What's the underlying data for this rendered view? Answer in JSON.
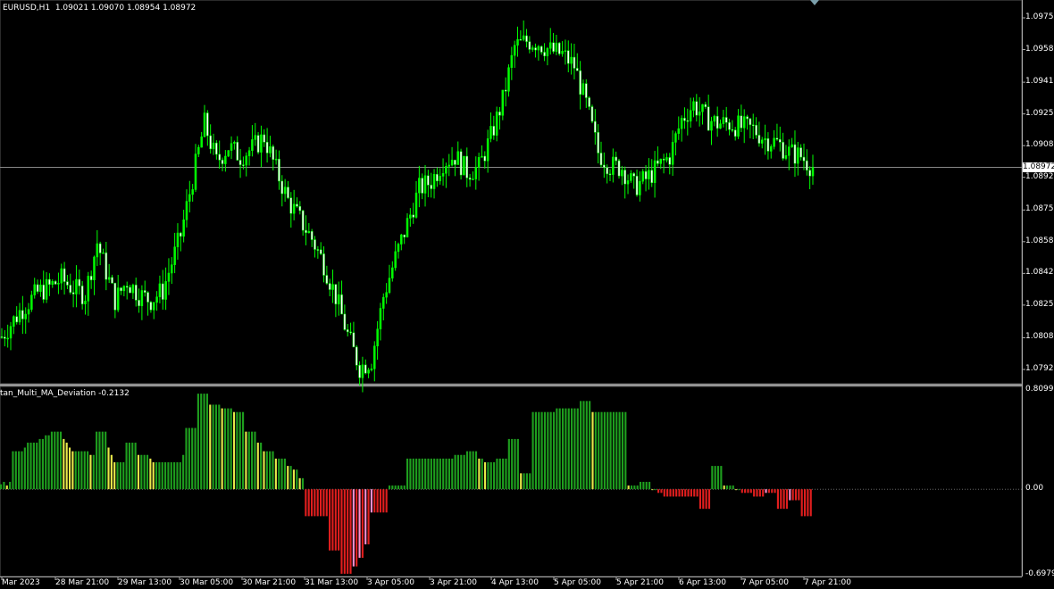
{
  "main_panel": {
    "symbol_info": "EURUSD,H1  1.09021 1.09070 1.08954 1.08972",
    "current_price": "1.08972",
    "price_labels": [
      "1.09750",
      "1.09585",
      "1.09415",
      "1.09250",
      "1.09085",
      "1.08920",
      "1.08750",
      "1.08585",
      "1.08420",
      "1.08255",
      "1.08085",
      "1.07920"
    ]
  },
  "indicator_panel": {
    "name": "tan_Multi_MA_Deviation -0.2132",
    "scale_labels": [
      "0.8099",
      "0.00",
      "-0.6979"
    ]
  },
  "time_labels": [
    "Mar 2023",
    "28 Mar 21:00",
    "29 Mar 13:00",
    "30 Mar 05:00",
    "30 Mar 21:00",
    "31 Mar 13:00",
    "3 Apr 05:00",
    "3 Apr 21:00",
    "4 Apr 13:00",
    "5 Apr 05:00",
    "5 Apr 21:00",
    "6 Apr 13:00",
    "7 Apr 05:00",
    "7 Apr 21:00"
  ],
  "colors": {
    "background": "#000000",
    "bull_candle": "#00ff00",
    "bear_candle": "#ffffff",
    "wick": "#00ff00",
    "dev_strong_up": "#1e9e1e",
    "dev_weak_up": "#e8e84a",
    "dev_strong_down": "#e01e1e",
    "dev_weak_down": "#ff8fd0",
    "grid_line": "#888888",
    "text": "#ffffff"
  },
  "chart_data": [
    {
      "type": "candlestick",
      "title": "EURUSD,H1",
      "yaxis_range": [
        1.0785,
        1.0985
      ],
      "anchor_prices": [
        [
          0,
          1.0809
        ],
        [
          6,
          1.0822
        ],
        [
          12,
          1.0832
        ],
        [
          16,
          1.0835
        ],
        [
          20,
          1.0839
        ],
        [
          24,
          1.0834
        ],
        [
          28,
          1.0831
        ],
        [
          32,
          1.0858
        ],
        [
          38,
          1.0828
        ],
        [
          42,
          1.0838
        ],
        [
          46,
          1.0831
        ],
        [
          50,
          1.0828
        ],
        [
          54,
          1.0833
        ],
        [
          60,
          1.0862
        ],
        [
          64,
          1.0891
        ],
        [
          68,
          1.092
        ],
        [
          72,
          1.09
        ],
        [
          76,
          1.0908
        ],
        [
          80,
          1.0903
        ],
        [
          84,
          1.0907
        ],
        [
          88,
          1.0913
        ],
        [
          92,
          1.0896
        ],
        [
          96,
          1.088
        ],
        [
          100,
          1.087
        ],
        [
          104,
          1.086
        ],
        [
          108,
          1.0847
        ],
        [
          112,
          1.083
        ],
        [
          116,
          1.081
        ],
        [
          120,
          1.0793
        ],
        [
          124,
          1.0797
        ],
        [
          128,
          1.083
        ],
        [
          132,
          1.085
        ],
        [
          136,
          1.0868
        ],
        [
          140,
          1.0886
        ],
        [
          144,
          1.089
        ],
        [
          148,
          1.09
        ],
        [
          152,
          1.0903
        ],
        [
          156,
          1.0895
        ],
        [
          160,
          1.0897
        ],
        [
          164,
          1.0913
        ],
        [
          168,
          1.0932
        ],
        [
          172,
          1.096
        ],
        [
          176,
          1.0963
        ],
        [
          180,
          1.0962
        ],
        [
          184,
          1.0958
        ],
        [
          188,
          1.0956
        ],
        [
          192,
          1.095
        ],
        [
          196,
          1.093
        ],
        [
          200,
          1.0905
        ],
        [
          204,
          1.0898
        ],
        [
          208,
          1.0897
        ],
        [
          212,
          1.0887
        ],
        [
          216,
          1.0891
        ],
        [
          220,
          1.0897
        ],
        [
          224,
          1.0903
        ],
        [
          228,
          1.0922
        ],
        [
          232,
          1.093
        ],
        [
          236,
          1.0923
        ],
        [
          240,
          1.092
        ],
        [
          244,
          1.092
        ],
        [
          248,
          1.0918
        ],
        [
          252,
          1.0917
        ],
        [
          256,
          1.0912
        ],
        [
          260,
          1.091
        ],
        [
          264,
          1.0905
        ],
        [
          268,
          1.0903
        ],
        [
          272,
          1.0897
        ]
      ]
    },
    {
      "type": "bar",
      "title": "tan_Multi_MA_Deviation",
      "yaxis_range": [
        -0.6979,
        0.8099
      ],
      "values": [
        0.04,
        0.06,
        0.03,
        0.06,
        0.31,
        0.31,
        0.31,
        0.31,
        0.34,
        0.38,
        0.38,
        0.38,
        0.38,
        0.41,
        0.41,
        0.44,
        0.44,
        0.47,
        0.47,
        0.47,
        0.47,
        0.41,
        0.38,
        0.34,
        0.31,
        0.31,
        0.31,
        0.31,
        0.31,
        0.31,
        0.28,
        0.28,
        0.47,
        0.47,
        0.47,
        0.47,
        0.34,
        0.28,
        0.22,
        0.22,
        0.22,
        0.22,
        0.38,
        0.38,
        0.38,
        0.38,
        0.28,
        0.28,
        0.28,
        0.28,
        0.25,
        0.22,
        0.22,
        0.22,
        0.22,
        0.22,
        0.22,
        0.22,
        0.22,
        0.22,
        0.22,
        0.28,
        0.5,
        0.5,
        0.5,
        0.5,
        0.78,
        0.78,
        0.78,
        0.78,
        0.69,
        0.69,
        0.69,
        0.69,
        0.66,
        0.66,
        0.66,
        0.66,
        0.63,
        0.63,
        0.63,
        0.63,
        0.47,
        0.47,
        0.47,
        0.47,
        0.38,
        0.38,
        0.31,
        0.31,
        0.31,
        0.31,
        0.25,
        0.25,
        0.25,
        0.25,
        0.19,
        0.19,
        0.16,
        0.16,
        0.09,
        0.09,
        -0.22,
        -0.22,
        -0.22,
        -0.22,
        -0.22,
        -0.22,
        -0.22,
        -0.22,
        -0.5,
        -0.5,
        -0.5,
        -0.5,
        -0.69,
        -0.69,
        -0.69,
        -0.69,
        -0.63,
        -0.63,
        -0.56,
        -0.56,
        -0.45,
        -0.45,
        -0.19,
        -0.19,
        -0.19,
        -0.19,
        -0.19,
        -0.19,
        0.03,
        0.03,
        0.03,
        0.03,
        0.03,
        0.03,
        0.25,
        0.25,
        0.25,
        0.25,
        0.25,
        0.25,
        0.25,
        0.25,
        0.25,
        0.25,
        0.25,
        0.25,
        0.25,
        0.25,
        0.25,
        0.25,
        0.28,
        0.28,
        0.28,
        0.28,
        0.31,
        0.31,
        0.31,
        0.31,
        0.25,
        0.25,
        0.22,
        0.22,
        0.22,
        0.22,
        0.25,
        0.25,
        0.25,
        0.25,
        0.41,
        0.41,
        0.41,
        0.41,
        0.13,
        0.13,
        0.13,
        0.13,
        0.63,
        0.63,
        0.63,
        0.63,
        0.63,
        0.63,
        0.63,
        0.63,
        0.66,
        0.66,
        0.66,
        0.66,
        0.66,
        0.66,
        0.66,
        0.66,
        0.72,
        0.72,
        0.72,
        0.72,
        0.63,
        0.63,
        0.63,
        0.63,
        0.63,
        0.63,
        0.63,
        0.63,
        0.63,
        0.63,
        0.63,
        0.63,
        0.03,
        0.03,
        0.03,
        0.03,
        0.06,
        0.06,
        0.06,
        0.06,
        0.0,
        0.0,
        -0.03,
        -0.03,
        -0.06,
        -0.06,
        -0.06,
        -0.06,
        -0.06,
        -0.06,
        -0.06,
        -0.06,
        -0.06,
        -0.06,
        -0.06,
        -0.06,
        -0.16,
        -0.16,
        -0.16,
        -0.16,
        0.19,
        0.19,
        0.19,
        0.19,
        0.03,
        0.03,
        0.03,
        0.03,
        0.0,
        0.0,
        -0.03,
        -0.03,
        -0.03,
        -0.03,
        -0.06,
        -0.06,
        -0.06,
        -0.06,
        -0.03,
        -0.03,
        -0.03,
        -0.03,
        -0.16,
        -0.16,
        -0.16,
        -0.16,
        -0.09,
        -0.09,
        -0.09,
        -0.09,
        -0.22,
        -0.22,
        -0.22,
        -0.22
      ]
    }
  ]
}
